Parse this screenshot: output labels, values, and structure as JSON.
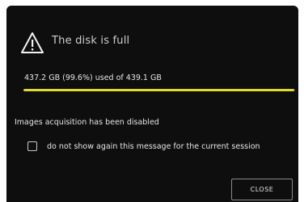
{
  "dialog": {
    "title": "The disk is full",
    "title_icon": "warning-icon",
    "usage_text": "437.2 GB (99.6%) used of 439.1 GB",
    "usage_percent": 99.6,
    "message": "Images acquisition has been disabled",
    "checkbox_label": "do not show again this message for the current session",
    "checkbox_checked": false,
    "close_label": "CLOSE"
  },
  "colors": {
    "background": "#0e0e0e",
    "accent": "#e2da2a",
    "text": "#e6e6e6"
  }
}
